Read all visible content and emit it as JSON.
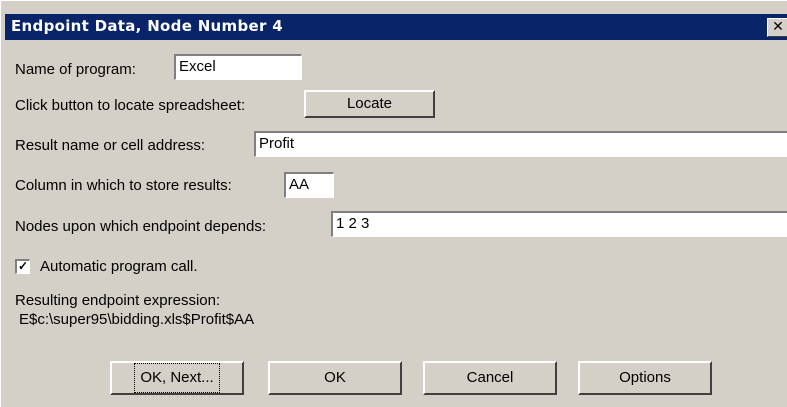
{
  "window": {
    "title": "Endpoint Data, Node Number 4",
    "close_glyph": "✕"
  },
  "form": {
    "program_label": "Name of program:",
    "program_value": "Excel",
    "locate_label": "Click button to locate spreadsheet:",
    "locate_button": "Locate",
    "result_label": "Result name or cell address:",
    "result_value": "Profit",
    "column_label": "Column in which to store results:",
    "column_value": "AA",
    "nodes_label": "Nodes upon which endpoint depends:",
    "nodes_value": "1 2 3",
    "auto_call_label": "Automatic program call.",
    "auto_call_checked": true,
    "check_glyph": "✓",
    "expression_label": "Resulting endpoint expression:",
    "expression_value": "E$c:\\super95\\bidding.xls$Profit$AA"
  },
  "buttons": {
    "ok_next": "OK, Next...",
    "ok": "OK",
    "cancel": "Cancel",
    "options": "Options"
  }
}
